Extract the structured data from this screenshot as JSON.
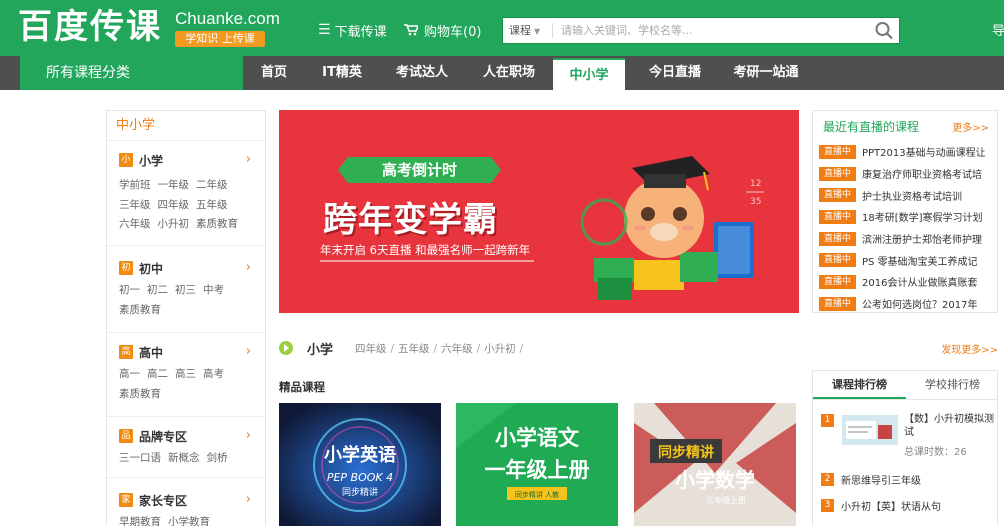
{
  "header": {
    "logo_text": "百度传课",
    "brand": "Chuanke.com",
    "slogan": "学知识 上传课",
    "download_label": "下载传课",
    "cart_label": "购物车(0)",
    "search_category": "课程",
    "search_placeholder": "请输入关键词、学校名等...",
    "right_truncated": "导"
  },
  "nav": {
    "all_categories": "所有课程分类",
    "items": [
      {
        "label": "首页"
      },
      {
        "label": "IT精英"
      },
      {
        "label": "考试达人"
      },
      {
        "label": "人在职场"
      },
      {
        "label": "中小学",
        "active": true
      },
      {
        "label": "今日直播"
      },
      {
        "label": "考研一站通"
      }
    ]
  },
  "sidebar": {
    "title": "中小学",
    "sections": [
      {
        "badge": "小",
        "name": "小学",
        "links": [
          "学前班",
          "一年级",
          "二年级",
          "三年级",
          "四年级",
          "五年级",
          "六年级",
          "小升初",
          "素质教育"
        ]
      },
      {
        "badge": "初",
        "name": "初中",
        "links": [
          "初一",
          "初二",
          "初三",
          "中考",
          "素质教育"
        ]
      },
      {
        "badge": "高",
        "name": "高中",
        "links": [
          "高一",
          "高二",
          "高三",
          "高考",
          "素质教育"
        ]
      },
      {
        "badge": "品",
        "name": "品牌专区",
        "links": [
          "三一口语",
          "新概念",
          "剑桥"
        ]
      },
      {
        "badge": "家",
        "name": "家长专区",
        "links": [
          "早期教育",
          "小学教育"
        ]
      }
    ]
  },
  "banner": {
    "tag": "高考倒计时",
    "headline": "跨年变学霸",
    "subline": "年末开启 6天直播  和最强名师一起跨新年"
  },
  "live": {
    "title": "最近有直播的课程",
    "more": "更多>>",
    "badge": "直播中",
    "items": [
      "PPT2013基础与动画课程让",
      "康复治疗师职业资格考试培",
      "护士执业资格考试培训",
      "18考研[数学]寒假学习计划",
      "滨洲注册护士郑怡老师护理",
      "PS 零基础淘宝美工养成记",
      "2016会计从业做账真账套",
      "公考如何选岗位？2017年"
    ]
  },
  "section": {
    "title": "小学",
    "links": [
      "四年级",
      "五年级",
      "六年级",
      "小升初"
    ],
    "more": "发现更多>>",
    "sub_label": "精品课程"
  },
  "cards": [
    {
      "title": "小学英语",
      "sub": "PEP BOOK 4",
      "tag": "同步精讲"
    },
    {
      "title": "小学语文",
      "title2": "一年级上册",
      "tag": "同步精讲 人教"
    },
    {
      "title": "同步精讲",
      "title2": "小学数学",
      "tag": "三年级上册"
    }
  ],
  "rank": {
    "tabs": [
      "课程排行榜",
      "学校排行榜"
    ],
    "top_title": "【数】小升初模拟测试",
    "top_sub": "总课时数：26",
    "items": [
      {
        "num": "1"
      },
      {
        "num": "2",
        "text": "新思维导引三年级"
      },
      {
        "num": "3",
        "text": "小升初【英】状语从句"
      }
    ]
  }
}
